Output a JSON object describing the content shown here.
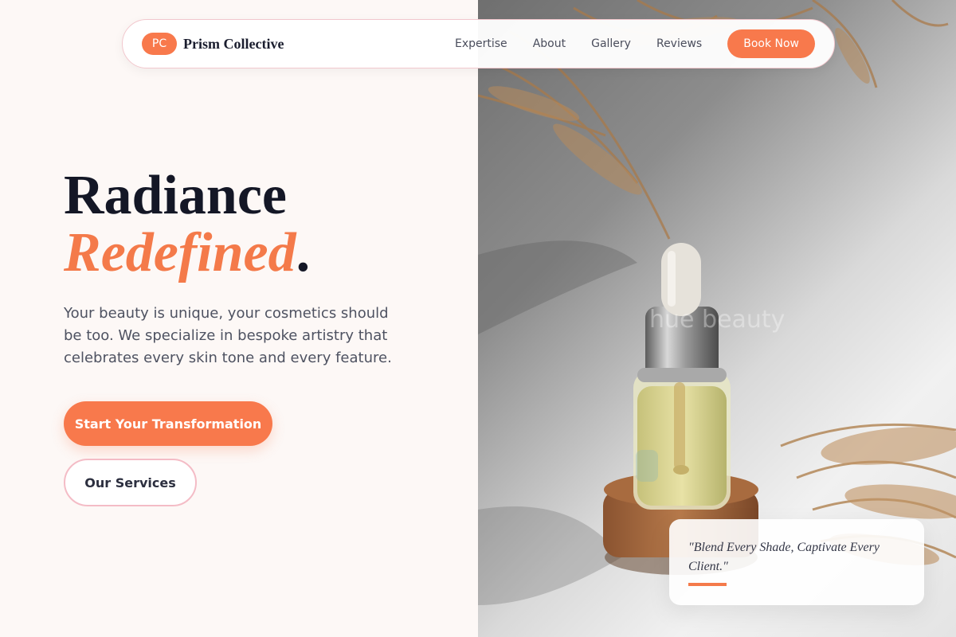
{
  "navbar": {
    "logo_badge": "PC",
    "brand_name": "Prism Collective",
    "links": [
      {
        "label": "Expertise"
      },
      {
        "label": "About"
      },
      {
        "label": "Gallery"
      },
      {
        "label": "Reviews"
      }
    ],
    "cta_label": "Book Now"
  },
  "hero": {
    "title_line1": "Radiance",
    "title_accent": "Redefined",
    "title_period": ".",
    "description": "Your beauty is unique, your cosmetics should be too. We specialize in bespoke artistry that celebrates every skin tone and every feature.",
    "primary_button": "Start Your Transformation",
    "secondary_button": "Our Services"
  },
  "image": {
    "watermark": "hue beauty"
  },
  "quote": {
    "text": "\"Blend Every Shade, Captivate Every Client.\""
  },
  "colors": {
    "accent": "#f8794c",
    "background": "#fdf8f6",
    "text_dark": "#141726",
    "border_pink": "#f4bcc6"
  }
}
